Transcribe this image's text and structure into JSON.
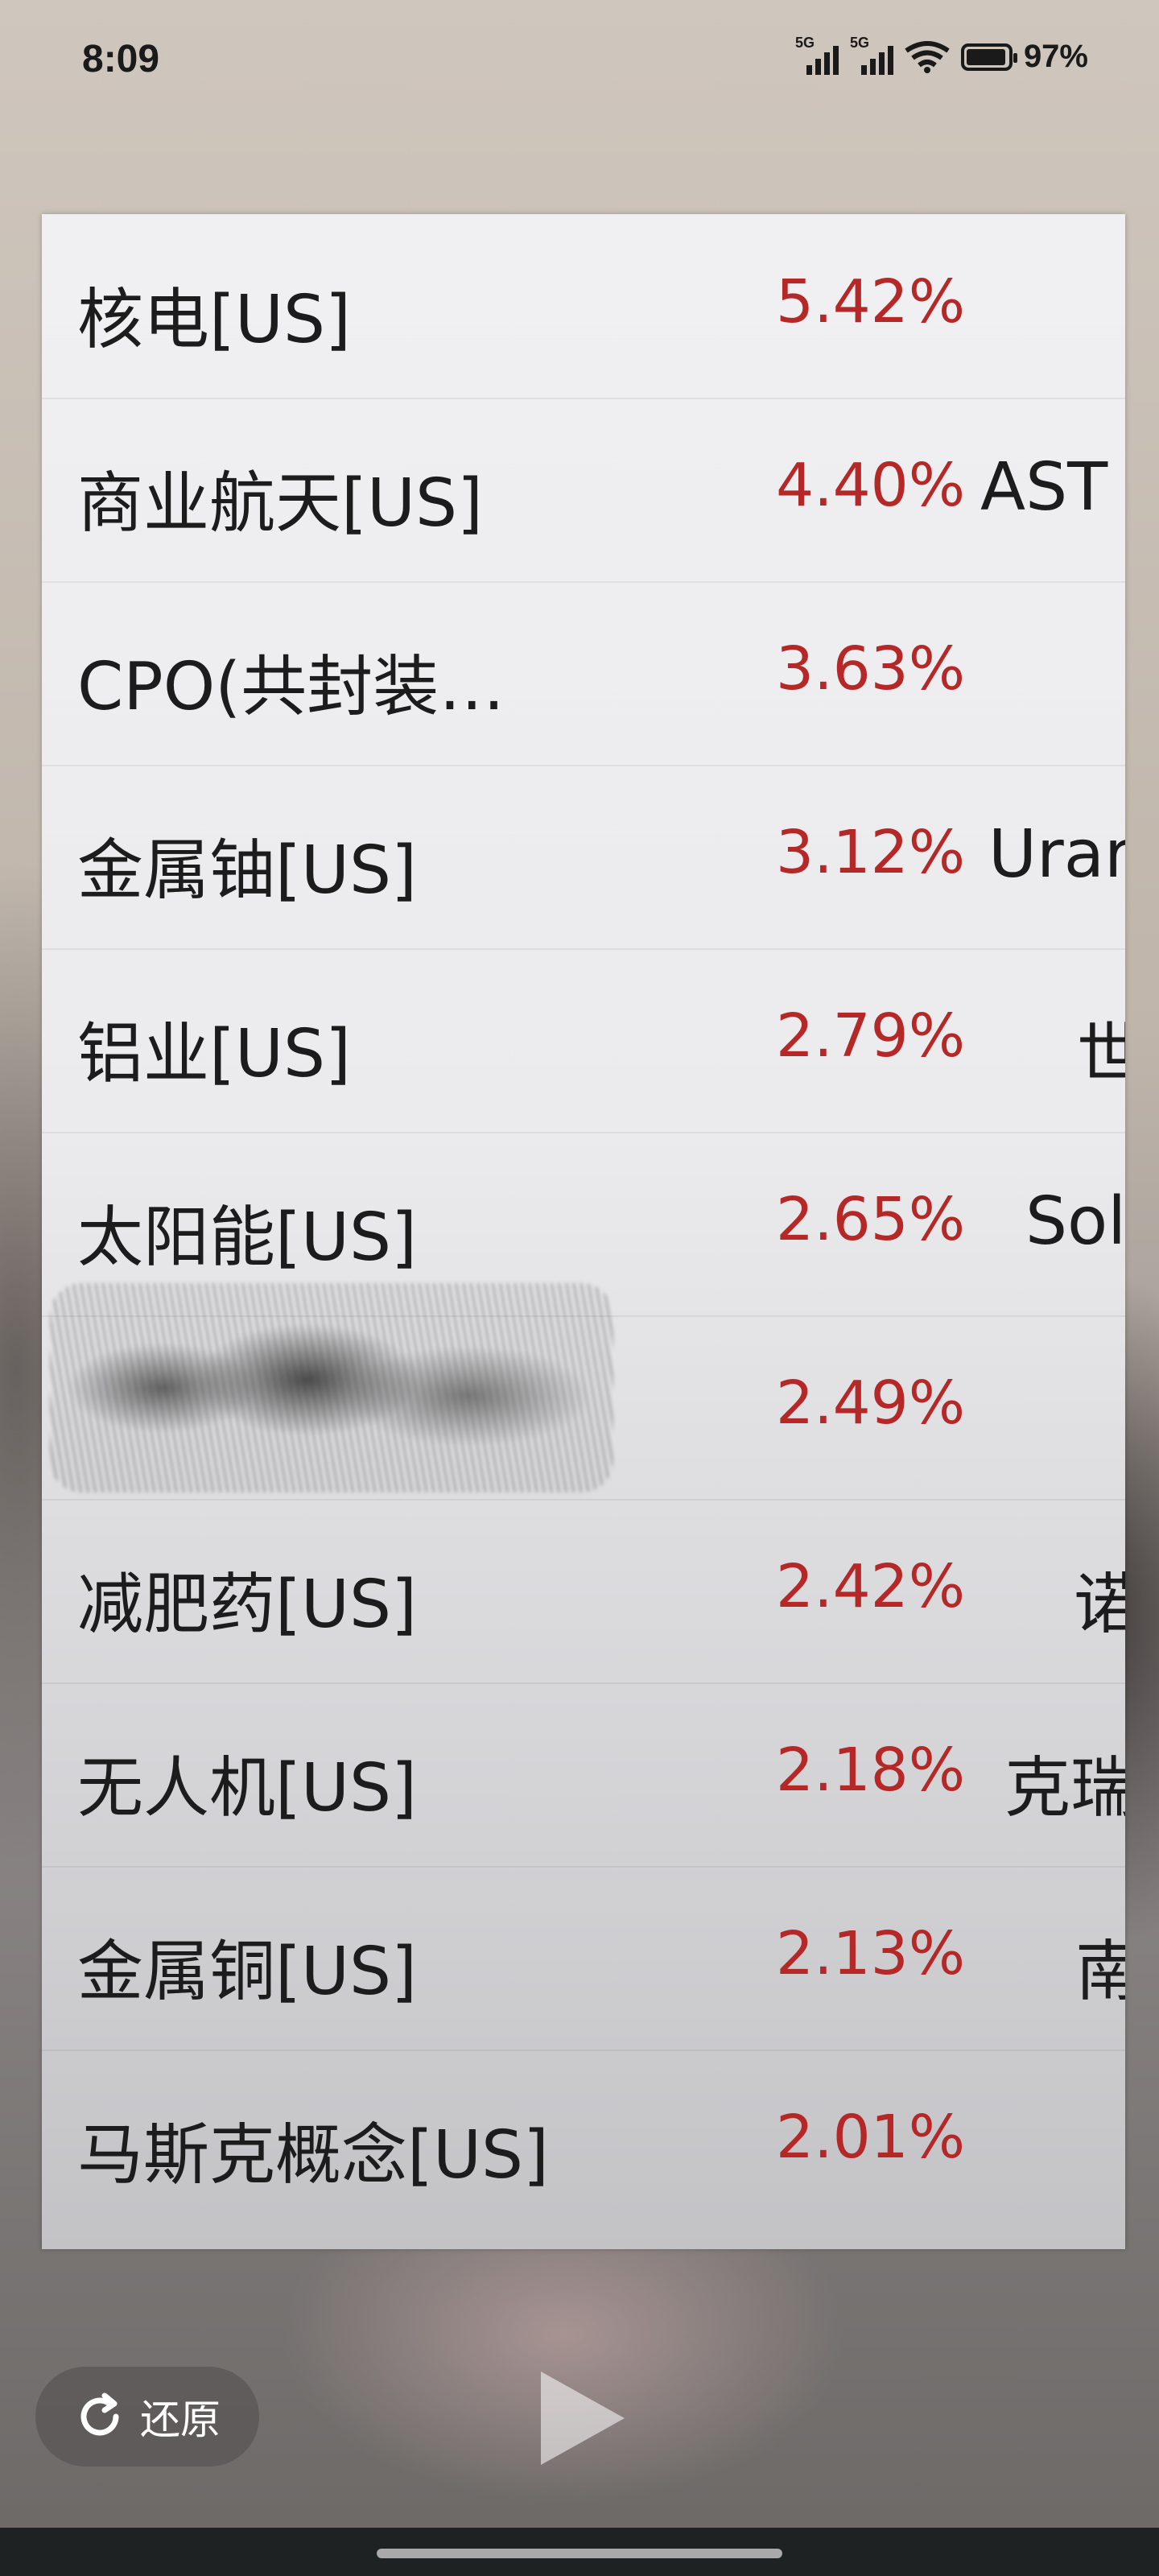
{
  "status_bar": {
    "time": "8:09",
    "signal1_label": "5G",
    "signal2_label": "5G",
    "battery": "97%"
  },
  "rows": [
    {
      "name": "核电[US]",
      "pct": "5.42%",
      "extra": ""
    },
    {
      "name": "商业航天[US]",
      "pct": "4.40%",
      "extra": "AST"
    },
    {
      "name": "CPO(共封装…",
      "pct": "3.63%",
      "extra": ""
    },
    {
      "name": "金属铀[US]",
      "pct": "3.12%",
      "extra": "Urar"
    },
    {
      "name": "铝业[US]",
      "pct": "2.79%",
      "extra": "世"
    },
    {
      "name": "太阳能[US]",
      "pct": "2.65%",
      "extra": "Sol"
    },
    {
      "name": "",
      "pct": "2.49%",
      "extra": ""
    },
    {
      "name": "减肥药[US]",
      "pct": "2.42%",
      "extra": "诺"
    },
    {
      "name": "无人机[US]",
      "pct": "2.18%",
      "extra": "克瑞"
    },
    {
      "name": "金属铜[US]",
      "pct": "2.13%",
      "extra": "南"
    },
    {
      "name": "马斯克概念[US]",
      "pct": "2.01%",
      "extra": ""
    }
  ],
  "controls": {
    "restore_label": "还原"
  },
  "colors": {
    "percent_red": "#b52828",
    "panel_bg": "#efeff1"
  }
}
